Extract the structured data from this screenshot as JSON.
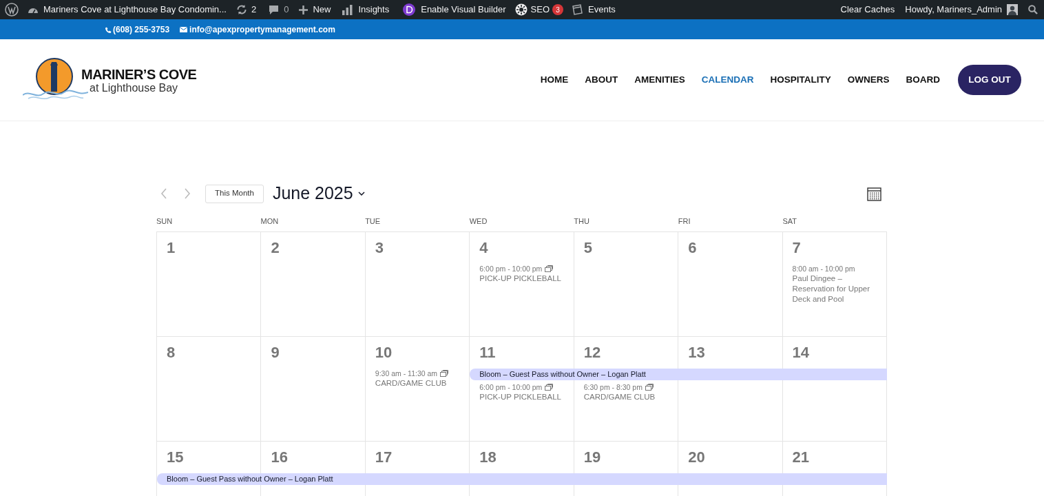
{
  "admin_bar": {
    "site_title": "Mariners Cove at Lighthouse Bay Condomin...",
    "updates": "2",
    "comments": "0",
    "new": "New",
    "insights": "Insights",
    "visual_builder": "Enable Visual Builder",
    "seo": "SEO",
    "seo_badge": "3",
    "events": "Events",
    "clear_caches": "Clear Caches",
    "howdy": "Howdy, Mariners_Admin"
  },
  "contact_bar": {
    "phone": "(608) 255-3753",
    "email": "info@apexpropertymanagement.com"
  },
  "logo": {
    "title": "MARINER’S COVE",
    "subtitle": "at Lighthouse Bay"
  },
  "nav": [
    {
      "label": "HOME",
      "selected": false
    },
    {
      "label": "ABOUT",
      "selected": false
    },
    {
      "label": "AMENITIES",
      "selected": false
    },
    {
      "label": "CALENDAR",
      "selected": true
    },
    {
      "label": "HOSPITALITY",
      "selected": false
    },
    {
      "label": "OWNERS",
      "selected": false
    },
    {
      "label": "BOARD",
      "selected": false
    }
  ],
  "logout": "LOG OUT",
  "calendar": {
    "today_button": "This Month",
    "month": "June 2025",
    "weekdays": [
      "SUN",
      "MON",
      "TUE",
      "WED",
      "THU",
      "FRI",
      "SAT"
    ],
    "weeks": [
      {
        "days": [
          {
            "number": "1"
          },
          {
            "number": "2"
          },
          {
            "number": "3"
          },
          {
            "number": "4",
            "events": [
              {
                "time": "6:00 pm - 10:00 pm",
                "title": "PICK-UP PICKLEBALL",
                "recurring": true
              }
            ]
          },
          {
            "number": "5"
          },
          {
            "number": "6"
          },
          {
            "number": "7",
            "events": [
              {
                "time": "8:00 am - 10:00 pm",
                "title": "Paul Dingee – Reservation for Upper Deck and Pool",
                "recurring": false
              }
            ]
          }
        ]
      },
      {
        "days": [
          {
            "number": "8"
          },
          {
            "number": "9"
          },
          {
            "number": "10",
            "events": [
              {
                "time": "9:30 am - 11:30 am",
                "title": "CARD/GAME CLUB",
                "recurring": true
              }
            ]
          },
          {
            "number": "11",
            "multiday": {
              "title": "Bloom – Guest Pass without Owner – Logan Platt"
            },
            "events": [
              {
                "time": "6:00 pm - 10:00 pm",
                "title": "PICK-UP PICKLEBALL",
                "recurring": true
              }
            ]
          },
          {
            "number": "12",
            "multiday_continues": true,
            "events": [
              {
                "time": "6:30 pm - 8:30 pm",
                "title": "CARD/GAME CLUB",
                "recurring": true
              }
            ]
          },
          {
            "number": "13",
            "multiday_continues": true
          },
          {
            "number": "14",
            "multiday_continues": true
          }
        ]
      },
      {
        "days": [
          {
            "number": "15",
            "multiday": {
              "title": "Bloom – Guest Pass without Owner – Logan Platt"
            }
          },
          {
            "number": "16",
            "multiday_continues": true
          },
          {
            "number": "17",
            "multiday_continues": true
          },
          {
            "number": "18",
            "multiday_continues": true
          },
          {
            "number": "19",
            "multiday_continues": true
          },
          {
            "number": "20",
            "multiday_continues": true
          },
          {
            "number": "21",
            "multiday_continues": true
          }
        ]
      }
    ]
  }
}
